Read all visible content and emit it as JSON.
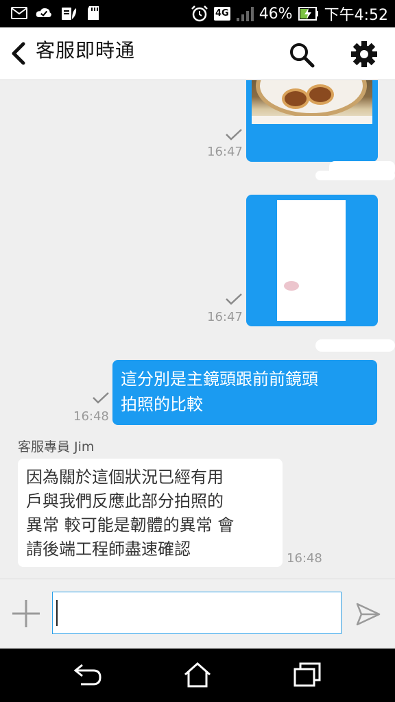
{
  "status_bar": {
    "battery": "46%",
    "network": "4G",
    "time": "下午4:52"
  },
  "app_bar": {
    "title": "客服即時通"
  },
  "chat": {
    "messages": [
      {
        "type": "image",
        "direction": "out",
        "time": "16:47",
        "status": "sent"
      },
      {
        "type": "image",
        "direction": "out",
        "time": "16:47",
        "status": "sent"
      },
      {
        "type": "text",
        "direction": "out",
        "text_lines": [
          "這分別是主鏡頭跟前前鏡頭",
          "拍照的比較"
        ],
        "time": "16:48",
        "status": "sent"
      },
      {
        "type": "text",
        "direction": "in",
        "sender": "客服專員 Jim",
        "text_lines": [
          "因為關於這個狀況已經有用",
          "戶與我們反應此部分拍照的",
          "異常  較可能是韌體的異常 會",
          "請後端工程師盡速確認"
        ],
        "time": "16:48"
      }
    ]
  },
  "input_bar": {
    "value": "",
    "placeholder": ""
  },
  "colors": {
    "accent": "#1b9bf1",
    "chat_bg": "#efefef",
    "status_bar": "#000000"
  },
  "icons": {
    "back": "chevron-left-icon",
    "search": "search-icon",
    "settings": "gear-icon",
    "add": "plus-icon",
    "send": "send-icon"
  }
}
